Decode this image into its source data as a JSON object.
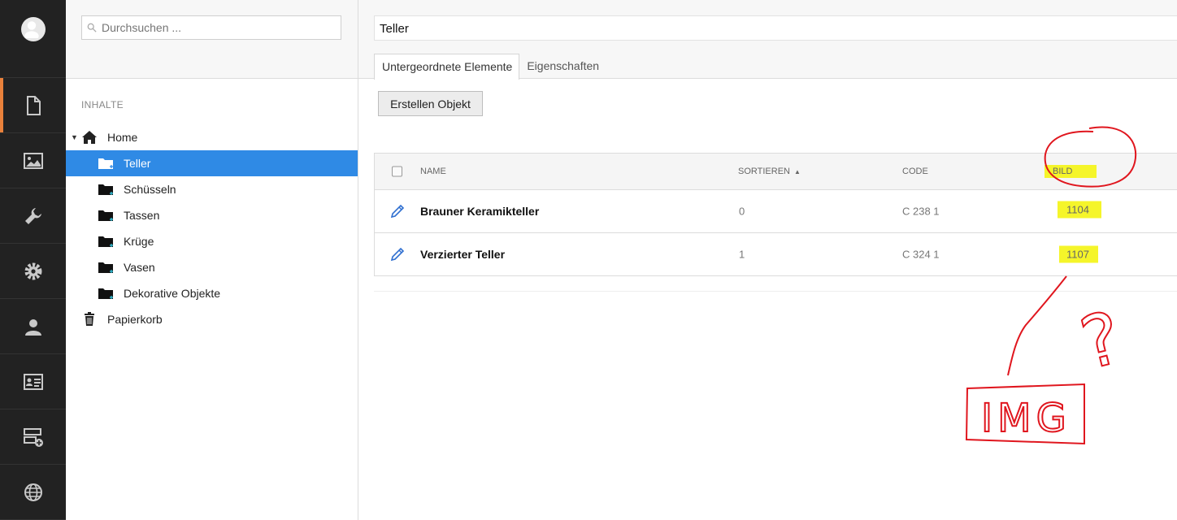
{
  "sidebar": {
    "items": [
      {
        "name": "documents",
        "icon": "document-icon",
        "active": true
      },
      {
        "name": "assets",
        "icon": "image-icon",
        "active": false
      },
      {
        "name": "tools",
        "icon": "wrench-icon",
        "active": false
      },
      {
        "name": "settings",
        "icon": "gear-icon",
        "active": false
      },
      {
        "name": "users",
        "icon": "user-icon",
        "active": false
      },
      {
        "name": "contacts",
        "icon": "id-card-icon",
        "active": false
      },
      {
        "name": "layouts",
        "icon": "layout-add-icon",
        "active": false
      },
      {
        "name": "sites",
        "icon": "globe-icon",
        "active": false
      }
    ],
    "accent_color": "#e9813b"
  },
  "tree": {
    "search_placeholder": "Durchsuchen ...",
    "section_label": "INHALTE",
    "home_label": "Home",
    "nodes": [
      {
        "label": "Teller"
      },
      {
        "label": "Schüsseln"
      },
      {
        "label": "Tassen"
      },
      {
        "label": "Krüge"
      },
      {
        "label": "Vasen"
      },
      {
        "label": "Dekorative Objekte"
      }
    ],
    "trash_label": "Papierkorb",
    "selected_color": "#2f8ae5"
  },
  "main": {
    "title_value": "Teller",
    "tabs": [
      {
        "label": "Untergeordnete Elemente",
        "active": true
      },
      {
        "label": "Eigenschaften",
        "active": false
      }
    ],
    "create_button": "Erstellen Objekt",
    "table": {
      "columns": {
        "name": "NAME",
        "sort": "SORTIEREN",
        "code": "CODE",
        "image": "BILD"
      },
      "rows": [
        {
          "name": "Brauner Keramikteller",
          "sort": "0",
          "code": "C 238 1",
          "image": "1104"
        },
        {
          "name": "Verzierter Teller",
          "sort": "1",
          "code": "C 324 1",
          "image": "1107"
        }
      ]
    }
  },
  "annotation": {
    "question_mark": "?",
    "box_text": "IMG",
    "color": "#e0161e",
    "highlight_color": "#f5f52a"
  }
}
